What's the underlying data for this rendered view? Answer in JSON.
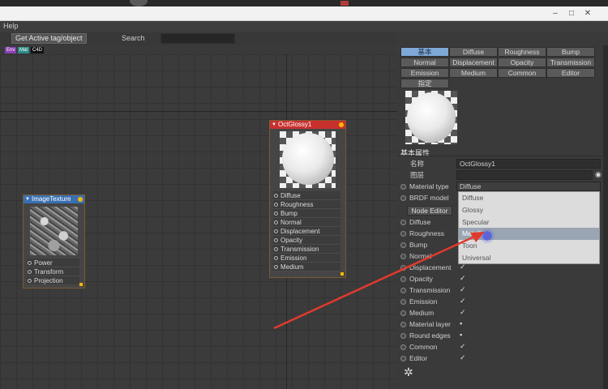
{
  "window": {
    "minimize": "–",
    "maximize": "□",
    "close": "✕"
  },
  "menu": {
    "help": "Help"
  },
  "toolbar": {
    "active_button": "Get Active tag/object",
    "search_label": "Search"
  },
  "tags": [
    "Env",
    "Mat",
    "C4D"
  ],
  "nodes": {
    "image_texture": {
      "title": "ImageTexture",
      "ports": [
        "Power",
        "Transform",
        "Projection"
      ]
    },
    "oct_glossy": {
      "title": "OctGlossy1",
      "ports": [
        "Diffuse",
        "Roughness",
        "Bump",
        "Normal",
        "Displacement",
        "Opacity",
        "Transmission",
        "Emission",
        "Medium"
      ]
    }
  },
  "tabs": [
    "基本",
    "Diffuse",
    "Roughness",
    "Bump",
    "Normal",
    "Displacement",
    "Opacity",
    "Transmission",
    "Emission",
    "Medium",
    "Common",
    "Editor",
    "指定"
  ],
  "panel": {
    "section_header": "基本属性",
    "name_label": "名称",
    "name_value": "OctGlossy1",
    "layer_label": "图层",
    "material_type_label": "Material type",
    "material_type_value": "Diffuse",
    "brdf_label": "BRDF model",
    "node_editor_button": "Node Editor",
    "params": [
      "Diffuse",
      "Roughness",
      "Bump",
      "Normal",
      "Displacement",
      "Opacity",
      "Transmission",
      "Emission",
      "Medium",
      "Material layer",
      "Round edges",
      "Common",
      "Editor"
    ]
  },
  "dropdown": {
    "options": [
      "Diffuse",
      "Glossy",
      "Specular",
      "Metallic",
      "Toon",
      "Universal"
    ],
    "highlighted": "Metallic"
  },
  "colors": {
    "selected_tab": "#7ea8d6",
    "node_header_red": "#c8302e",
    "node_header_blue": "#3a6fb0",
    "arrow": "#e03a2e"
  }
}
